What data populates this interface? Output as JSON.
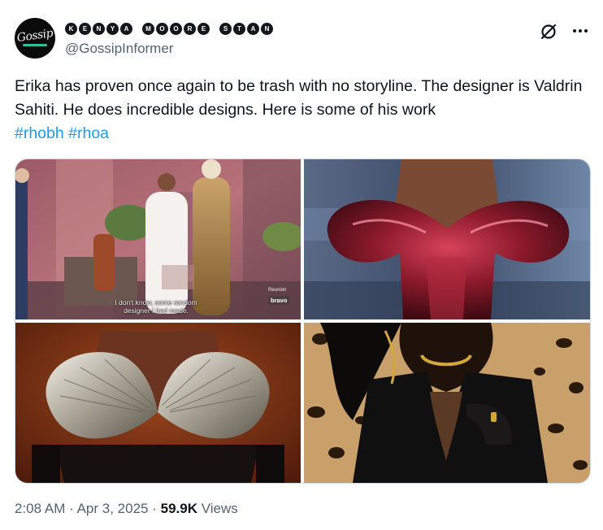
{
  "author": {
    "display_name_letters": [
      "K",
      "E",
      "N",
      "Y",
      "A",
      " ",
      "M",
      "O",
      "O",
      "R",
      "E",
      " ",
      "S",
      "T",
      "A",
      "N"
    ],
    "handle": "@GossipInformer",
    "avatar_text": "Gossip"
  },
  "tweet": {
    "text_main": "Erika has proven once again to be trash with no storyline. The designer is Valdrin Sahiti. He does incredible designs. Here is some of his work ",
    "hashtags": [
      "#rhobh",
      "#rhoa"
    ]
  },
  "media": {
    "image1_subtitle_line1": "I don't know, some random",
    "image1_subtitle_line2": "designer I had made.",
    "image1_small_bug": "Reunion",
    "image1_network": "bravo"
  },
  "footer": {
    "time": "2:08 AM",
    "separator": "·",
    "date": "Apr 3, 2025",
    "views_count": "59.9K",
    "views_label": "Views"
  },
  "icons": {
    "grok": "grok-icon",
    "more": "more-icon"
  },
  "colors": {
    "text": "#0f1419",
    "secondary": "#536471",
    "link": "#1d9bf0",
    "border": "#cfd9de"
  }
}
